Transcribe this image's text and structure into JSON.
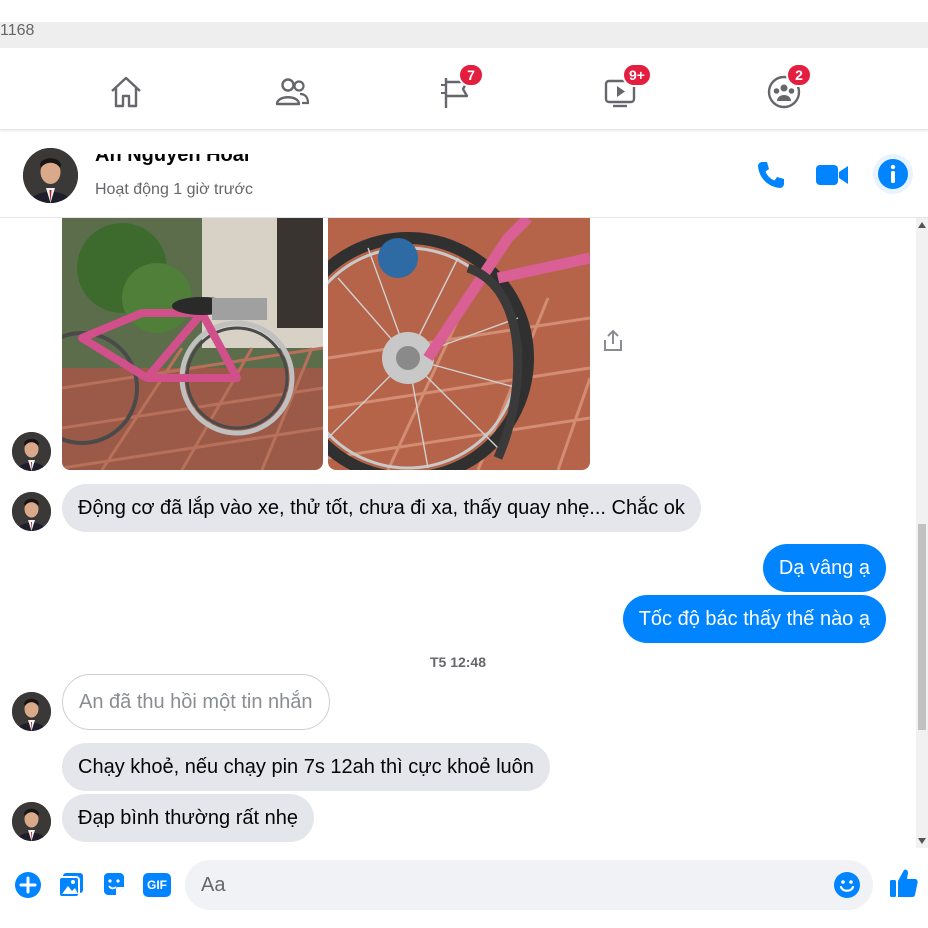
{
  "browser": {
    "url_fragment": "1168"
  },
  "nav": {
    "items": [
      {
        "name": "home",
        "badge": ""
      },
      {
        "name": "friends",
        "badge": ""
      },
      {
        "name": "pages",
        "badge": "7"
      },
      {
        "name": "watch",
        "badge": "9+"
      },
      {
        "name": "groups",
        "badge": "2"
      }
    ]
  },
  "chat": {
    "name": "An Nguyễn Hoài",
    "status": "Hoạt động 1 giờ trước"
  },
  "messages": {
    "m1": "Động cơ đã lắp vào xe, thử tốt, chưa đi xa, thấy quay nhẹ... Chắc ok",
    "m2": "Dạ vâng ạ",
    "m3": "Tốc độ bác thấy thế nào ạ",
    "timestamp": "T5 12:48",
    "m4": "An đã thu hồi một tin nhắn",
    "m5": "Chạy khoẻ, nếu chạy pin 7s 12ah thì cực khoẻ luôn",
    "m6": "Đạp bình thường rất nhẹ"
  },
  "composer": {
    "placeholder": "Aa",
    "gif_label": "GIF"
  },
  "colors": {
    "messenger_blue": "#0084ff",
    "incoming_bubble": "#e4e6eb",
    "badge_red": "#e41e3f",
    "icon_blue": "#0084ff"
  }
}
